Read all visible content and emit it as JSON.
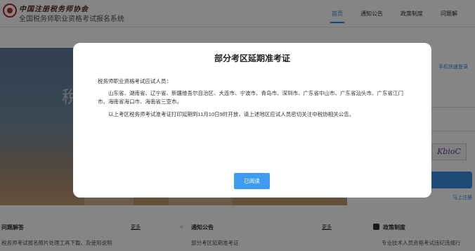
{
  "header": {
    "brand_calligraphy": "中国注册税务师协会",
    "site_title": "全国税务师职业资格考试报名系统",
    "nav": [
      {
        "label": "首页",
        "active": true
      },
      {
        "label": "通知公告",
        "active": false
      },
      {
        "label": "政策制度",
        "active": false
      },
      {
        "label": "问题解",
        "active": false
      }
    ]
  },
  "login": {
    "phone_login_link": "手机快速登录",
    "captcha_text": "KbioC",
    "register_link": "马上注册"
  },
  "bottom": {
    "columns": [
      {
        "title": "问题解答",
        "more": "更多",
        "item": "税务师考试报名照片处理工具下载、及使用说明"
      },
      {
        "title": "通知公告",
        "more": "更多",
        "item": "部分考区延期准考证"
      },
      {
        "title": "政策制度",
        "item": "专业技术人员资格考试违纪违规行"
      }
    ]
  },
  "modal": {
    "title": "部分考区延期准考证",
    "greeting": "税务师职业资格考试应试人员：",
    "regions": "山东省、湖南省、辽宁省、新疆维吾尔自治区、大连市、宁波市、青岛市、深圳市、广东省中山市、广东省汕头市、广东省江门市、海南省海口市、海南省三亚市。",
    "notice": "以上考区税务师考试准考证打印延期到11月10日9时开放，请上述地区应试人员密切关注中税协相关公告。",
    "confirm_label": "已阅读"
  },
  "colors": {
    "accent": "#2e86de",
    "button": "#3d9bf0",
    "overlay": "rgba(0,0,0,0.48)"
  }
}
